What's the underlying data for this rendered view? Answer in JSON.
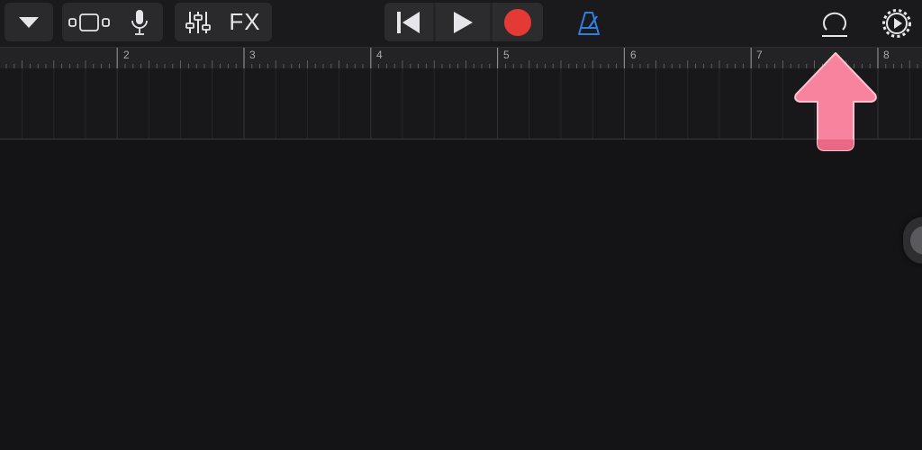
{
  "toolbar": {
    "fx_label": "FX",
    "record_color": "#e53935",
    "metronome_color": "#2f7fe0",
    "icons": [
      "tracks-dropdown-icon",
      "tracks-view-icon",
      "microphone-icon",
      "mixer-icon",
      "rewind-icon",
      "play-icon",
      "record-icon",
      "metronome-icon",
      "loop-browser-icon",
      "settings-icon"
    ]
  },
  "ruler": {
    "bar_numbers": [
      "2",
      "3",
      "4",
      "5",
      "6",
      "7",
      "8"
    ]
  },
  "annotation": {
    "arrow_color": "#f7839f"
  }
}
